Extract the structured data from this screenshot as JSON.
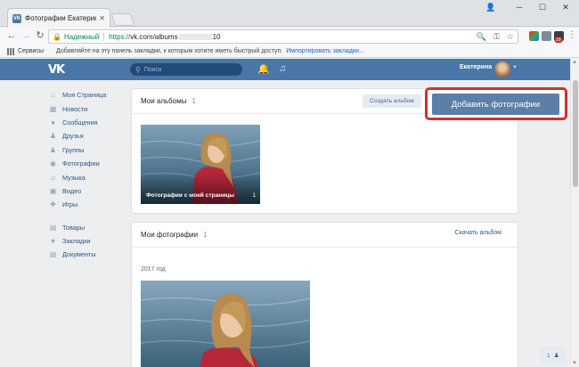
{
  "browser": {
    "tab_title": "Фотографии Екатерины",
    "url_secure_label": "Надежный",
    "url_scheme": "https://",
    "url_path": "vk.com/albums",
    "url_tail": "10",
    "bookmarks": {
      "services_label": "Сервисы",
      "hint_text": "Добавляйте на эту панель закладки, к которым хотите иметь быстрый доступ.",
      "import_link": "Импортировать закладки..."
    },
    "extension_badge": "10"
  },
  "vk_header": {
    "logo": "VK",
    "search_placeholder": "Поиск",
    "user_name": "Екатерина"
  },
  "sidebar": {
    "items": [
      {
        "icon": "home-icon",
        "glyph": "⌂",
        "label": "Моя Страница"
      },
      {
        "icon": "news-icon",
        "glyph": "▦",
        "label": "Новости"
      },
      {
        "icon": "messages-icon",
        "glyph": "●",
        "label": "Сообщения"
      },
      {
        "icon": "friends-icon",
        "glyph": "♟",
        "label": "Друзья"
      },
      {
        "icon": "groups-icon",
        "glyph": "♟",
        "label": "Группы"
      },
      {
        "icon": "photos-icon",
        "glyph": "◉",
        "label": "Фотографии"
      },
      {
        "icon": "music-icon",
        "glyph": "♫",
        "label": "Музыка"
      },
      {
        "icon": "video-icon",
        "glyph": "▣",
        "label": "Видео"
      },
      {
        "icon": "games-icon",
        "glyph": "✚",
        "label": "Игры"
      }
    ],
    "secondary_items": [
      {
        "icon": "goods-icon",
        "glyph": "▤",
        "label": "Товары"
      },
      {
        "icon": "bookmarks-icon",
        "glyph": "★",
        "label": "Закладки"
      },
      {
        "icon": "documents-icon",
        "glyph": "▤",
        "label": "Документы"
      }
    ]
  },
  "albums": {
    "title": "Мои альбомы",
    "count": "1",
    "create_button": "Создать альбом",
    "add_photos_button": "Добавить фотографии",
    "album_caption": "Фотографии с моей страницы",
    "album_count": "1"
  },
  "photos": {
    "title": "Мои фотографии",
    "count": "1",
    "download_link": "Скачать альбом",
    "year": "2017 год"
  },
  "float_button": {
    "count": "1"
  },
  "colors": {
    "vk_blue": "#4a76a8",
    "highlight_red": "#d32f2f",
    "link": "#2a5885"
  }
}
